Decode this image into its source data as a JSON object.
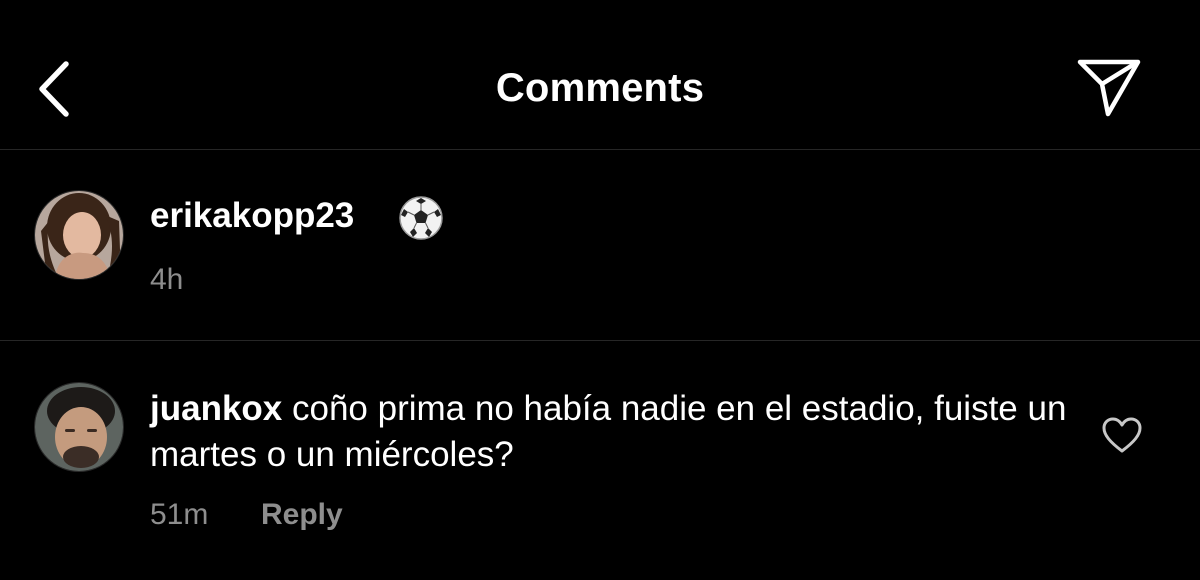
{
  "header": {
    "title": "Comments",
    "back_icon": "chevron-left-icon",
    "share_icon": "paper-plane-icon"
  },
  "caption": {
    "username": "erikakopp23",
    "emoji": "soccer-ball-icon",
    "time": "4h"
  },
  "comments": [
    {
      "username": "juankox",
      "text": "coño prima no había nadie en el estadio, fuiste un martes o un miércoles?",
      "time": "51m",
      "reply_label": "Reply",
      "like_icon": "heart-outline-icon"
    }
  ],
  "colors": {
    "background": "#000000",
    "primary_text": "#ffffff",
    "secondary_text": "#8e8e8e",
    "divider": "#262626"
  }
}
